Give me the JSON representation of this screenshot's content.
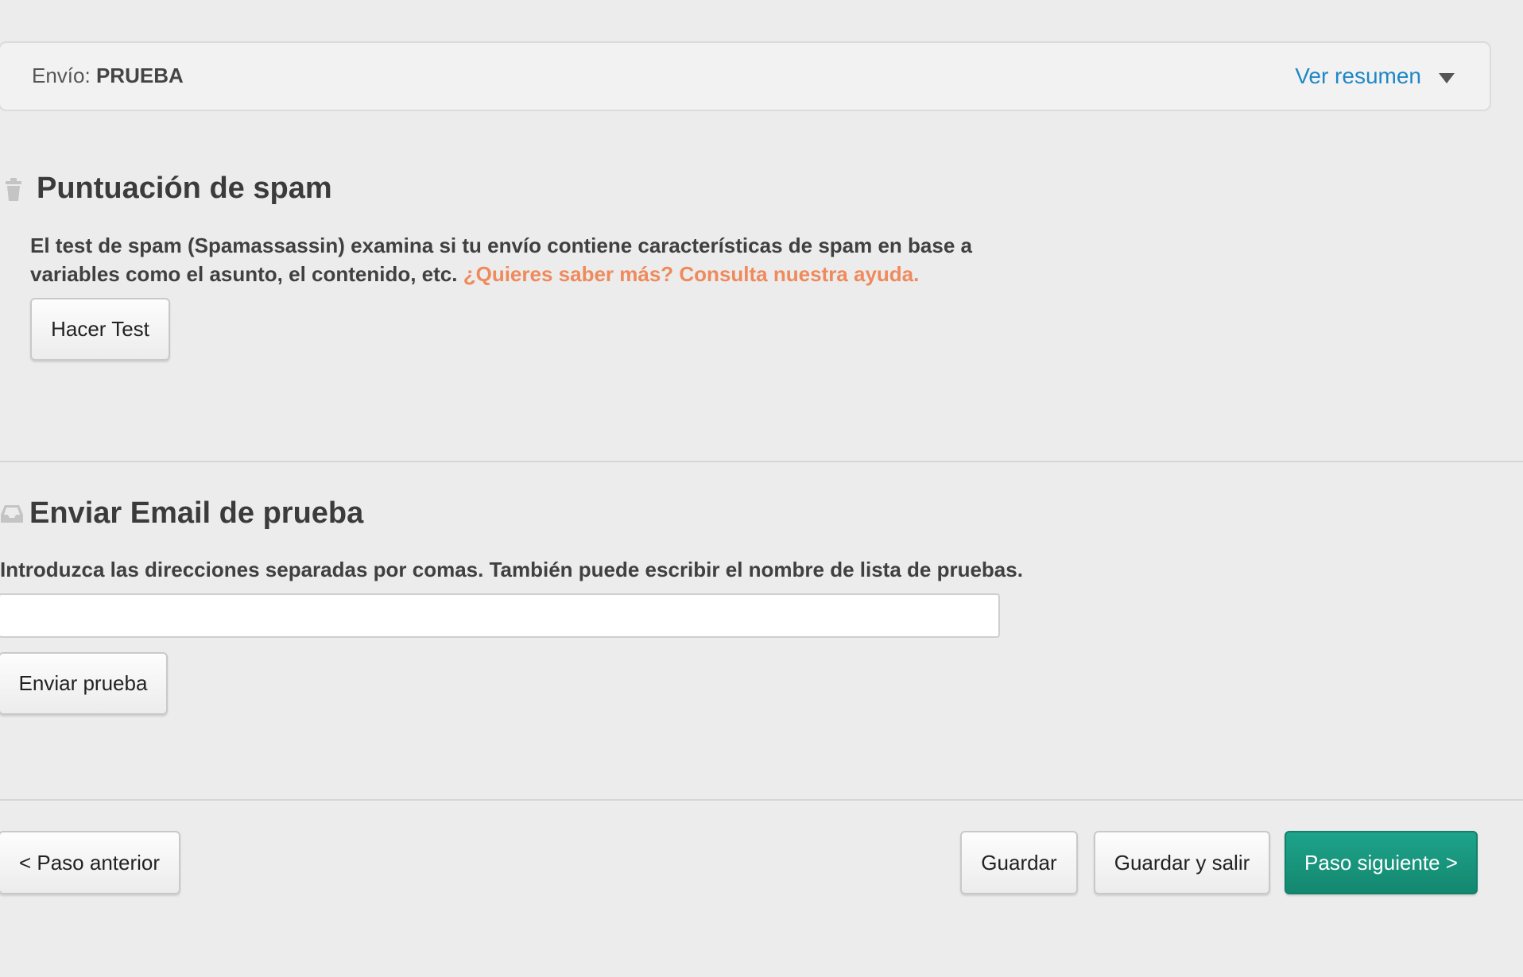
{
  "summary": {
    "label": "Envío:",
    "value": "PRUEBA",
    "toggle_label": "Ver resumen"
  },
  "spam_section": {
    "title": "Puntuación de spam",
    "description": "El test de spam (Spamassassin) examina si tu envío contiene características de spam en base a variables como el asunto, el contenido, etc.",
    "help_link": "¿Quieres saber más? Consulta nuestra ayuda.",
    "button_label": "Hacer Test"
  },
  "test_email_section": {
    "title": "Enviar Email de prueba",
    "description": "Introduzca las direcciones separadas por comas. También puede escribir el nombre de lista de pruebas.",
    "input_value": "",
    "input_placeholder": "",
    "button_label": "Enviar prueba"
  },
  "footer": {
    "prev_label": "< Paso anterior",
    "save_label": "Guardar",
    "save_exit_label": "Guardar y salir",
    "next_label": "Paso siguiente >"
  },
  "colors": {
    "link": "#1f87c6",
    "help_link": "#ef8a5c",
    "primary": "#1a9a82"
  }
}
